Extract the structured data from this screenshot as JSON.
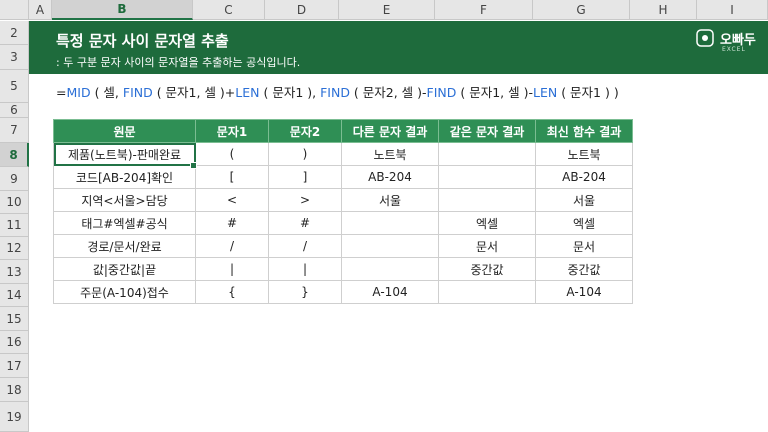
{
  "columns": [
    "A",
    "B",
    "C",
    "D",
    "E",
    "F",
    "G",
    "H",
    "I"
  ],
  "selected_column": "B",
  "rows": [
    "2",
    "3",
    "5",
    "6",
    "7",
    "8",
    "9",
    "10",
    "11",
    "12",
    "13",
    "14",
    "15",
    "16",
    "17",
    "18",
    "19"
  ],
  "selected_row": "8",
  "banner": {
    "title": "특정 문자 사이 문자열 추출",
    "subtitle": ": 두 구분 문자 사이의 문자열을 추출하는 공식입니다.",
    "logo_text": "오빠두",
    "logo_sub": "EXCEL",
    "color": "#1e6b3c"
  },
  "formula": {
    "parts": [
      {
        "text": "=",
        "fn": false
      },
      {
        "text": "MID",
        "fn": true
      },
      {
        "text": " ( 셀, ",
        "fn": false
      },
      {
        "text": "FIND",
        "fn": true
      },
      {
        "text": " ( 문자1, 셀 )+",
        "fn": false
      },
      {
        "text": "LEN",
        "fn": true
      },
      {
        "text": " ( 문자1 ), ",
        "fn": false
      },
      {
        "text": "FIND",
        "fn": true
      },
      {
        "text": " ( 문자2, 셀 )-",
        "fn": false
      },
      {
        "text": "FIND",
        "fn": true
      },
      {
        "text": " ( 문자1, 셀 )-",
        "fn": false
      },
      {
        "text": "LEN",
        "fn": true
      },
      {
        "text": " ( 문자1 ) )",
        "fn": false
      }
    ]
  },
  "table": {
    "headers": [
      "원문",
      "문자1",
      "문자2",
      "다른 문자 결과",
      "같은 문자 결과",
      "최신 함수 결과"
    ],
    "header_color": "#2f8f55",
    "rows": [
      [
        "제품(노트북)-판매완료",
        "(",
        ")",
        "노트북",
        "",
        "노트북"
      ],
      [
        "코드[AB-204]확인",
        "[",
        "]",
        "AB-204",
        "",
        "AB-204"
      ],
      [
        "지역<서울>담당",
        "<",
        ">",
        "서울",
        "",
        "서울"
      ],
      [
        "태그#엑셀#공식",
        "#",
        "#",
        "",
        "엑셀",
        "엑셀"
      ],
      [
        "경로/문서/완료",
        "/",
        "/",
        "",
        "문서",
        "문서"
      ],
      [
        "값|중간값|끝",
        "|",
        "|",
        "",
        "중간값",
        "중간값"
      ],
      [
        "주문(A-104)접수",
        "{",
        "}",
        "A-104",
        "",
        "A-104"
      ]
    ]
  }
}
